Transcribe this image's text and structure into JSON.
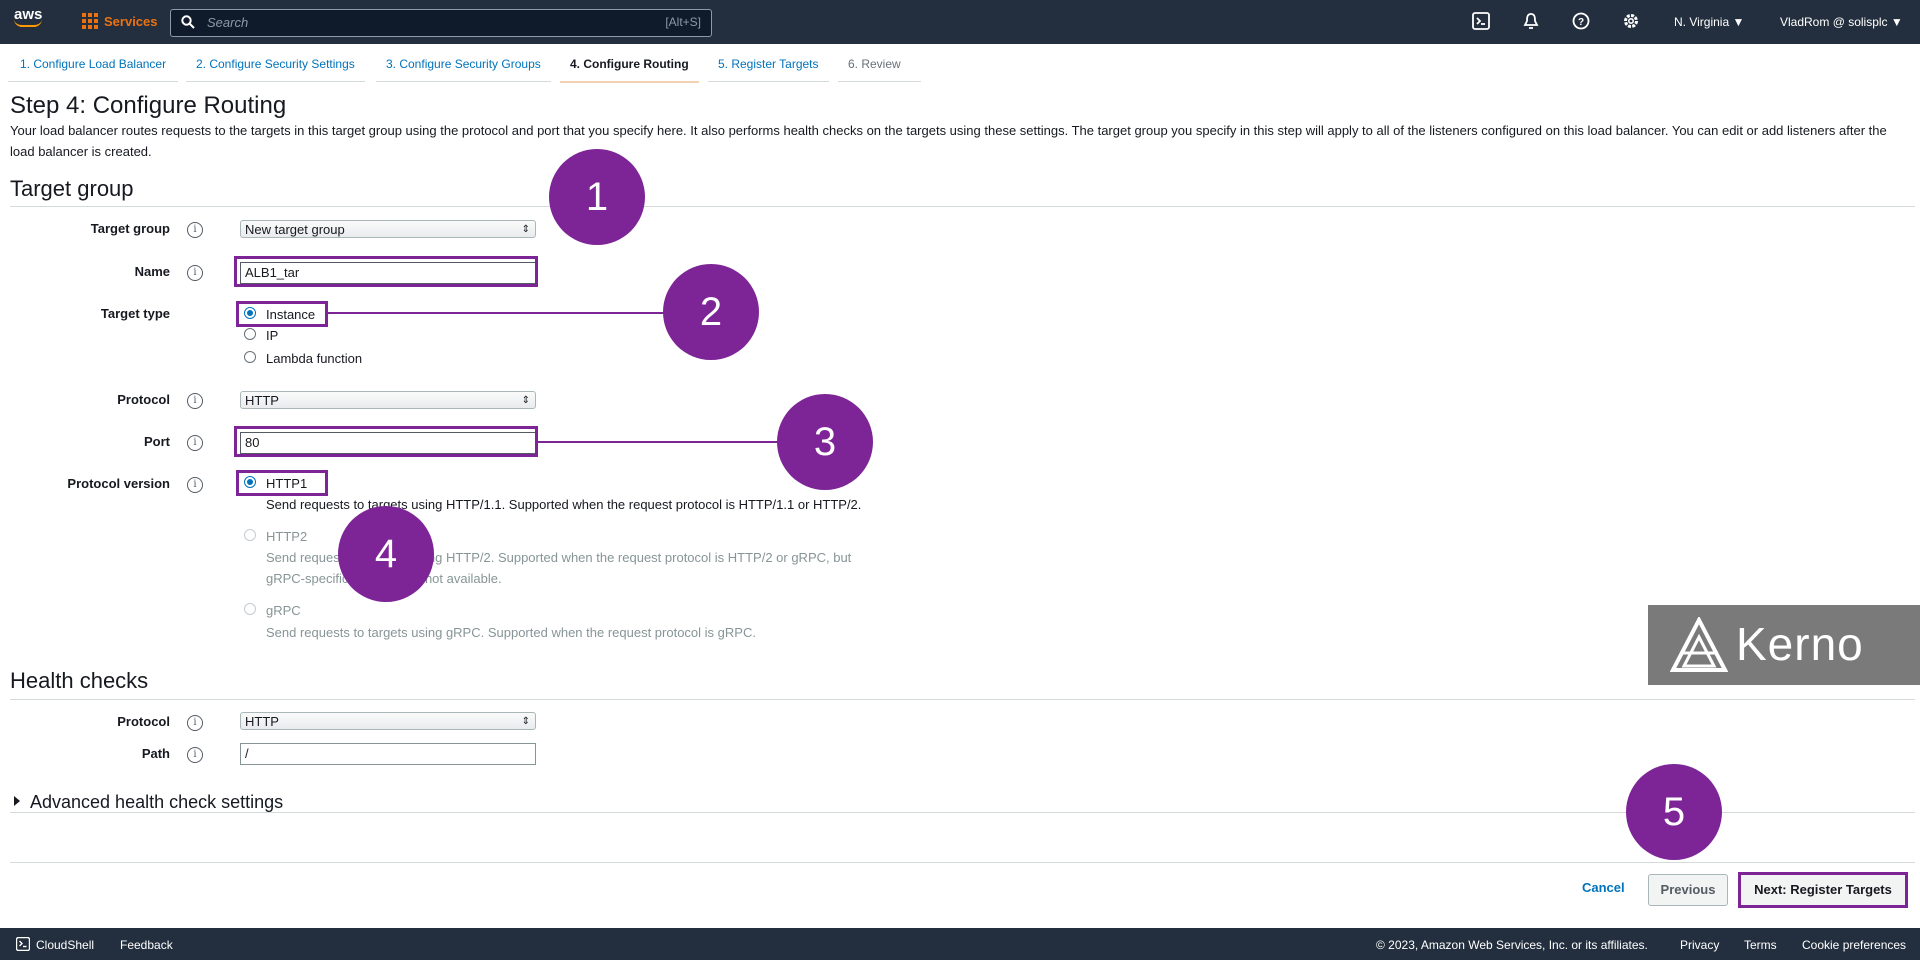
{
  "topnav": {
    "logo": "aws",
    "services": "Services",
    "search_placeholder": "Search",
    "search_shortcut": "[Alt+S]",
    "icons": [
      "cloudshell-icon",
      "bell-icon",
      "help-icon",
      "gear-icon"
    ],
    "region": "N. Virginia ▼",
    "account": "VladRom @ solisplc ▼"
  },
  "steps": [
    {
      "label": "1. Configure Load Balancer"
    },
    {
      "label": "2. Configure Security Settings"
    },
    {
      "label": "3. Configure Security Groups"
    },
    {
      "label": "4. Configure Routing"
    },
    {
      "label": "5. Register Targets"
    },
    {
      "label": "6. Review"
    }
  ],
  "page": {
    "title": "Step 4: Configure Routing",
    "description": "Your load balancer routes requests to the targets in this target group using the protocol and port that you specify here. It also performs health checks on the targets using these settings. The target group you specify in this step will apply to all of the listeners configured on this load balancer. You can edit or add listeners after the load balancer is created."
  },
  "target_group": {
    "section_title": "Target group",
    "target_group_label": "Target group",
    "target_group_value": "New target group",
    "name_label": "Name",
    "name_value": "ALB1_tar",
    "target_type_label": "Target type",
    "target_types": [
      "Instance",
      "IP",
      "Lambda function"
    ],
    "protocol_label": "Protocol",
    "protocol_value": "HTTP",
    "port_label": "Port",
    "port_value": "80",
    "protocol_version_label": "Protocol version",
    "versions": [
      {
        "label": "HTTP1",
        "desc": "Send requests to targets using HTTP/1.1. Supported when the request protocol is HTTP/1.1 or HTTP/2."
      },
      {
        "label": "HTTP2",
        "desc1": "Send requests to targets using HTTP/2. Supported when the request protocol is HTTP/2 or gRPC, but",
        "desc2": "gRPC-specific features are not available."
      },
      {
        "label": "gRPC",
        "desc": "Send requests to targets using gRPC. Supported when the request protocol is gRPC."
      }
    ]
  },
  "health_checks": {
    "section_title": "Health checks",
    "protocol_label": "Protocol",
    "protocol_value": "HTTP",
    "path_label": "Path",
    "path_value": "/",
    "advanced": "Advanced health check settings"
  },
  "buttons": {
    "cancel": "Cancel",
    "previous": "Previous",
    "next": "Next: Register Targets"
  },
  "annotations": [
    "1",
    "2",
    "3",
    "4",
    "5"
  ],
  "watermark": "Kerno",
  "footer": {
    "cloudshell": "CloudShell",
    "feedback": "Feedback",
    "copyright": "© 2023, Amazon Web Services, Inc. or its affiliates.",
    "privacy": "Privacy",
    "terms": "Terms",
    "cookies": "Cookie preferences"
  },
  "colors": {
    "nav_bg": "#232f3e",
    "accent": "#ec7211",
    "link": "#0073bb",
    "annotation": "#7d2596"
  }
}
